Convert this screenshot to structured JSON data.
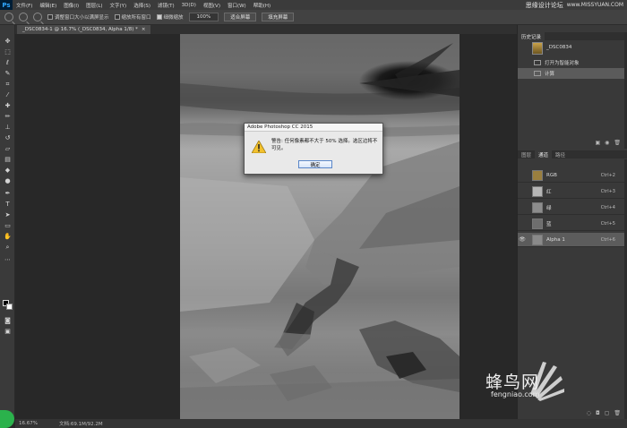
{
  "menubar": {
    "logo": "Ps",
    "items": [
      "文件(F)",
      "编辑(E)",
      "图像(I)",
      "图层(L)",
      "文字(Y)",
      "选择(S)",
      "滤镜(T)",
      "3D(D)",
      "视图(V)",
      "窗口(W)",
      "帮助(H)"
    ],
    "watermark": "思缘设计论坛",
    "watermark_url": "www.MISSYUAN.COM"
  },
  "options": {
    "resize_windows_label": "调整窗口大小以满屏显示",
    "resize_windows_checked": false,
    "zoom_all_label": "缩放所有窗口",
    "zoom_all_checked": false,
    "scrubby_zoom_label": "细微缩放",
    "scrubby_zoom_checked": true,
    "zoom_value": "100%",
    "fit_screen_label": "适合屏幕",
    "fill_screen_label": "填充屏幕"
  },
  "document": {
    "tab_title": "_DSC0834-1 @ 16.7% (_DSC0834, Alpha 1/8) *",
    "close_glyph": "×"
  },
  "dialog": {
    "title": "Adobe Photoshop CC 2015",
    "message": "警告: 任何像素都不大于 50% 选择。选区边将不可见。",
    "ok_label": "确定"
  },
  "history": {
    "tab_label": "历史记录",
    "snapshot_label": "_DSC0834",
    "items": [
      {
        "label": "打开为智能对象",
        "selected": false
      },
      {
        "label": "计算",
        "selected": true
      }
    ]
  },
  "channels": {
    "tabs": [
      {
        "label": "图层",
        "active": false
      },
      {
        "label": "通道",
        "active": true
      },
      {
        "label": "路径",
        "active": false
      }
    ],
    "rows": [
      {
        "name": "RGB",
        "shortcut": "Ctrl+2",
        "visible": false,
        "selected": false,
        "thumb": "#9a7f3f"
      },
      {
        "name": "红",
        "shortcut": "Ctrl+3",
        "visible": false,
        "selected": false,
        "thumb": "#b6b6b6"
      },
      {
        "name": "绿",
        "shortcut": "Ctrl+4",
        "visible": false,
        "selected": false,
        "thumb": "#8d8d8d"
      },
      {
        "name": "蓝",
        "shortcut": "Ctrl+5",
        "visible": false,
        "selected": false,
        "thumb": "#6e6e6e"
      },
      {
        "name": "Alpha 1",
        "shortcut": "Ctrl+6",
        "visible": true,
        "selected": true,
        "thumb": "#8a8a8a"
      }
    ]
  },
  "status": {
    "zoom": "16.67%",
    "doc_size": "文档:69.1M/92.2M"
  },
  "watermark_bottom": {
    "chinese": "蜂鸟网",
    "english": "fengniao.com"
  },
  "colors": {
    "arrow": "#e8262e",
    "dialog_ok_border": "#5a86c8",
    "ps_logo_text": "#31a8ff"
  }
}
